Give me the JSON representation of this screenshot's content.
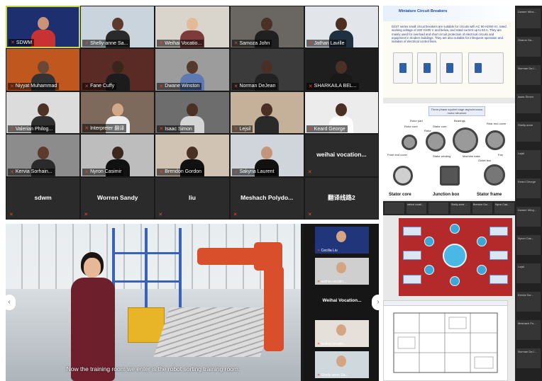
{
  "gallery": {
    "tiles": [
      {
        "name": "SDWM"
      },
      {
        "name": "Shelly-anne Sa..."
      },
      {
        "name": "Weihai Vocatio..."
      },
      {
        "name": "Samoza John"
      },
      {
        "name": "Jathan Laville"
      },
      {
        "name": "Niyyat Muhammad"
      },
      {
        "name": "Fane Cuffy"
      },
      {
        "name": "Dwane Winston"
      },
      {
        "name": "Norman DeJean"
      },
      {
        "name": "SHARKAILA BEL..."
      },
      {
        "name": "Valerian Philog..."
      },
      {
        "name": "Interpreter 翻译"
      },
      {
        "name": "Isaac Simon"
      },
      {
        "name": "Lejsil"
      },
      {
        "name": "Keard George"
      },
      {
        "name": "Kervia Sorhain..."
      },
      {
        "name": "Nyron Casimir"
      },
      {
        "name": "Brendon Gordon"
      },
      {
        "name": "Sakyna Laurent"
      },
      {
        "name": "weihai vocation..."
      },
      {
        "name": "sdwm"
      },
      {
        "name": "Worren Sandy"
      },
      {
        "name": "liu"
      },
      {
        "name": "Meshach Polydo..."
      },
      {
        "name": "翻译线路2"
      }
    ]
  },
  "slides": {
    "slide1": {
      "title": "Miniature Circuit Breakers",
      "paragraph": "DZ47 series small circuit breakers are suitable for circuits with AC 50 Hz/60 Hz, rated working voltage of 230 V/400 V and below, and rated current up to 63 A. They are mainly used for overload and short circuit protection of electrical circuits and equipment in modern buildings. They are also suitable for infrequent operation and isolation of electrical control lines."
    },
    "slide2": {
      "title": "Three-phase squirrel cage asynchronous motor structure",
      "parts": [
        "Rotor part",
        "Rotor core",
        "Stator core",
        "Rotor",
        "Bearings",
        "Rear end cover",
        "Front end cover",
        "Stator winding",
        "Machine base",
        "Fan",
        "Outlet box"
      ],
      "captions": [
        "Stator core",
        "Junction box",
        "Stator frame"
      ]
    },
    "strip": [
      "",
      "weihai vocati...",
      "",
      "Shelly-anne ...",
      "Brendon Gor...",
      "Nyron Casi..."
    ],
    "mini_sidebar": [
      "Dwane Wins...",
      "Sharon Sa...",
      "Norman DeJ...",
      "Isaac Simon",
      "Shelly-anne",
      "Lejsil",
      "Keard George",
      "Dwane Wing...",
      "Nyron Cas...",
      "Lejsil",
      "Kervia Sor...",
      "Meshach Po...",
      "Norman DeJ..."
    ]
  },
  "video": {
    "subtitle": "Now the training room we enter is the robot sorting training room.",
    "side_tiles": [
      {
        "name": "Cecilia Liu",
        "kind": "thumb"
      },
      {
        "name": "weihai vocatio...",
        "kind": "thumb"
      },
      {
        "name": "Weihai Vocation...",
        "kind": "text"
      },
      {
        "name": "weihai vocatio...",
        "kind": "thumb"
      },
      {
        "name": "Shelly-anne Sa...",
        "kind": "thumb"
      }
    ],
    "prev_arrow": "‹",
    "next_arrow": "›"
  },
  "colors": {
    "mic_muted": "#e5463a",
    "active_speaker": "#c9d83a",
    "slide_red": "#b42a2a",
    "robot_orange": "#d94f2b"
  }
}
